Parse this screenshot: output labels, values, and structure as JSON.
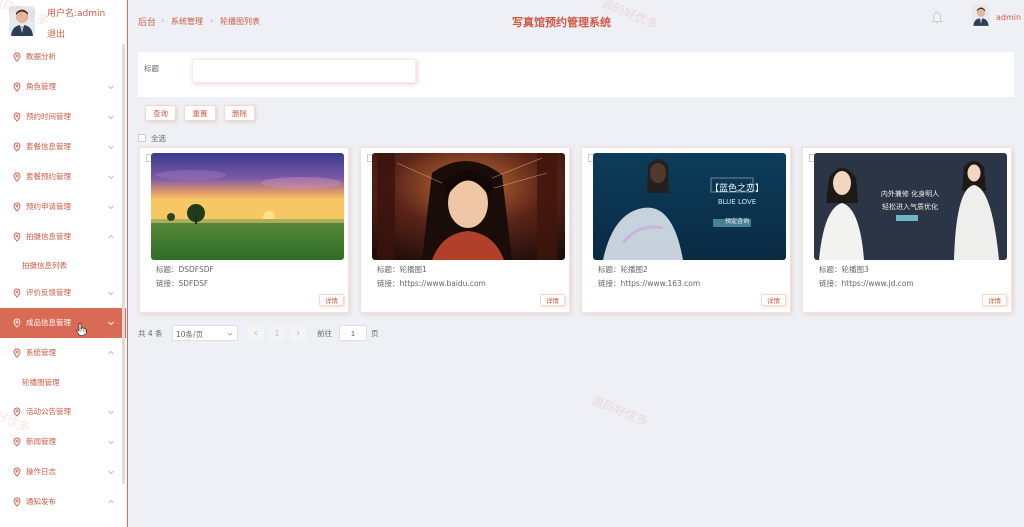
{
  "sidebar": {
    "username": "用户名:admin",
    "logout": "退出",
    "items": [
      {
        "label": "数据分析"
      },
      {
        "label": "角色管理"
      },
      {
        "label": "预约时间管理"
      },
      {
        "label": "套餐信息管理"
      },
      {
        "label": "套餐预约管理"
      },
      {
        "label": "预约申请管理"
      },
      {
        "label": "拍摄信息管理"
      },
      {
        "label": "拍摄信息列表"
      },
      {
        "label": "评价反馈管理"
      },
      {
        "label": "成品信息管理"
      },
      {
        "label": "系统管理"
      },
      {
        "label": "轮播图管理"
      },
      {
        "label": "活动公告管理"
      },
      {
        "label": "新闻管理"
      },
      {
        "label": "操作日志"
      },
      {
        "label": "通知发布"
      }
    ]
  },
  "header": {
    "breadcrumb": [
      "后台",
      "系统管理",
      "轮播图列表"
    ],
    "title": "写真馆预约管理系统",
    "admin": "admin"
  },
  "search": {
    "label": "标题",
    "value": ""
  },
  "actions": {
    "query": "查询",
    "reset": "重置",
    "delete": "删除",
    "select_all": "全选"
  },
  "cards": [
    {
      "title": "标题：DSDFSDF",
      "link": "链接：SDFDSF",
      "detail": "详情"
    },
    {
      "title": "标题：轮播图1",
      "link": "链接：https://www.baidu.com",
      "detail": "详情"
    },
    {
      "title": "标题：轮播图2",
      "link": "链接：https://www.163.com",
      "detail": "详情",
      "banner_lines": [
        "【蓝色之恋】",
        "BLUE LOVE",
        "预定咨询"
      ]
    },
    {
      "title": "标题：轮播图3",
      "link": "链接：https://www.jd.com",
      "detail": "详情",
      "banner_lines": [
        "内外兼修 化身明人",
        "轻松进入气质优化"
      ]
    }
  ],
  "pagination": {
    "total": "共 4 条",
    "page_size": "10条/页",
    "current": "1",
    "goto_label": "前往",
    "goto_value": "1",
    "unit": "页"
  },
  "watermark": "源码好优多",
  "colors": {
    "accent": "#d96a55",
    "text_accent": "#d05a45",
    "background": "#eef0f5"
  }
}
